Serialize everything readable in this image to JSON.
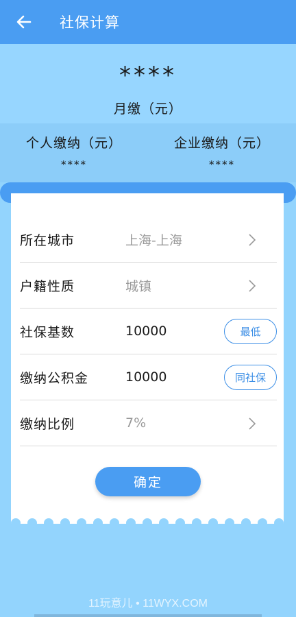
{
  "appbar": {
    "title": "社保计算",
    "back_icon": "arrow-left-icon"
  },
  "summary": {
    "total_value": "****",
    "total_label": "月缴（元）",
    "personal_label": "个人缴纳（元）",
    "personal_value": "****",
    "company_label": "企业缴纳（元）",
    "company_value": "****"
  },
  "form": {
    "rows": [
      {
        "label": "所在城市",
        "value": "上海-上海",
        "action": "chevron-right-icon"
      },
      {
        "label": "户籍性质",
        "value": "城镇",
        "action": "chevron-right-icon"
      },
      {
        "label": "社保基数",
        "value": "10000",
        "action_button": "最低"
      },
      {
        "label": "缴纳公积金",
        "value": "10000",
        "action_button": "同社保"
      },
      {
        "label": "缴纳比例",
        "value": "7%",
        "action": "chevron-right-icon"
      }
    ]
  },
  "confirm_label": "确定",
  "watermark": "11玩意儿 • 11WYX.COM",
  "colors": {
    "primary": "#4a9df2",
    "background": "#93d4fd",
    "outline": "#3b8ee6"
  }
}
